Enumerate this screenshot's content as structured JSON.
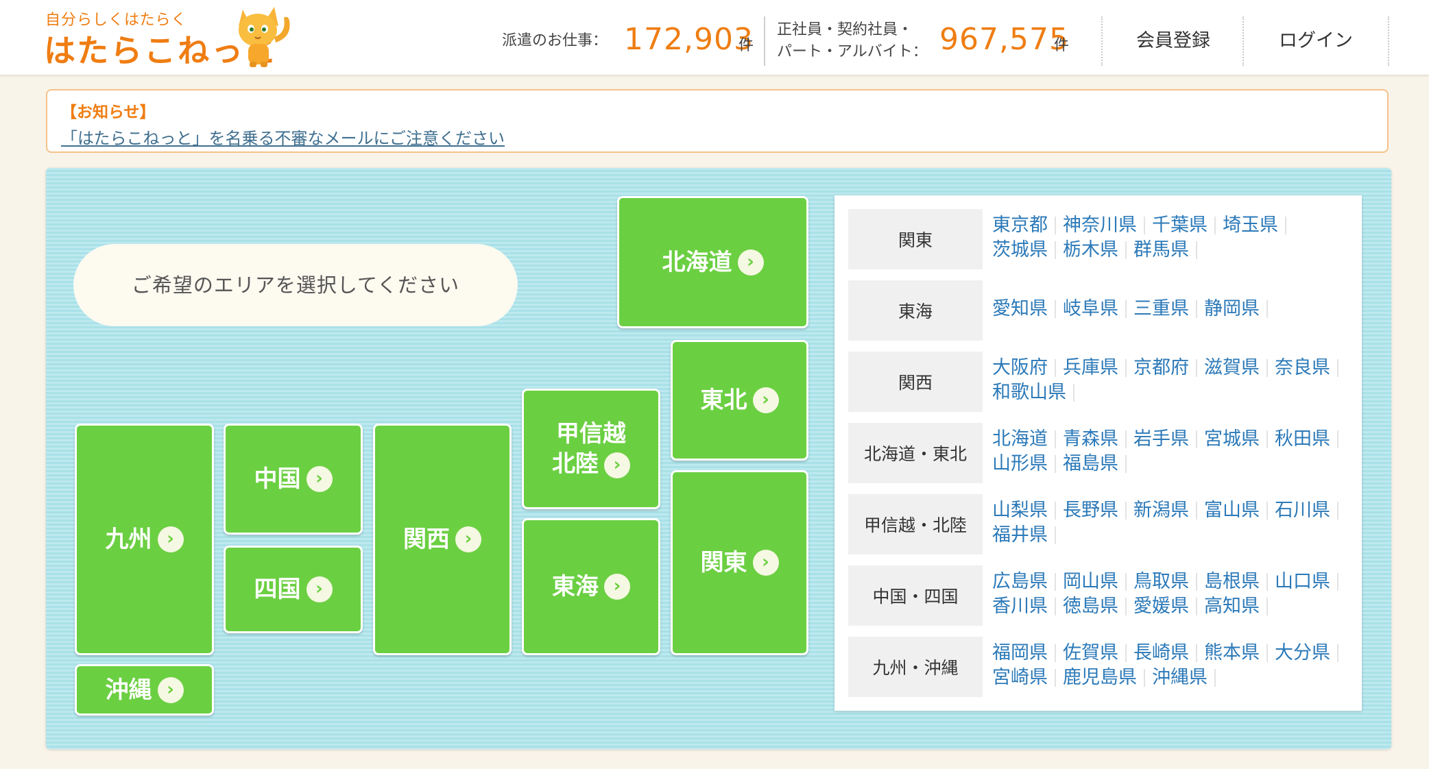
{
  "header": {
    "tagline": "自分らしくはたらく",
    "logo": "はたらこねっと",
    "haken_label": "派遣のお仕事：",
    "haken_count": "172,903",
    "haken_unit": "件",
    "seishain_label_1": "正社員・契約社員・",
    "seishain_label_2": "パート・アルバイト：",
    "seishain_count": "967,575",
    "seishain_unit": "件",
    "register": "会員登録",
    "login": "ログイン"
  },
  "notice": {
    "title": "【お知らせ】",
    "link": "「はたらこねっと」を名乗る不審なメールにご注意ください"
  },
  "map": {
    "prompt": "ご希望のエリアを選択してください",
    "arrow": "›",
    "regions": {
      "hokkaido": "北海道",
      "tohoku": "東北",
      "koshinetsu_1": "甲信越",
      "koshinetsu_2": "北陸",
      "kanto": "関東",
      "tokai": "東海",
      "kansai": "関西",
      "chugoku": "中国",
      "shikoku": "四国",
      "kyushu": "九州",
      "okinawa": "沖縄"
    }
  },
  "prefectures": [
    {
      "region": "関東",
      "prefs": [
        "東京都",
        "神奈川県",
        "千葉県",
        "埼玉県",
        "茨城県",
        "栃木県",
        "群馬県"
      ]
    },
    {
      "region": "東海",
      "prefs": [
        "愛知県",
        "岐阜県",
        "三重県",
        "静岡県"
      ]
    },
    {
      "region": "関西",
      "prefs": [
        "大阪府",
        "兵庫県",
        "京都府",
        "滋賀県",
        "奈良県",
        "和歌山県"
      ]
    },
    {
      "region": "北海道・東北",
      "prefs": [
        "北海道",
        "青森県",
        "岩手県",
        "宮城県",
        "秋田県",
        "山形県",
        "福島県"
      ]
    },
    {
      "region": "甲信越・北陸",
      "prefs": [
        "山梨県",
        "長野県",
        "新潟県",
        "富山県",
        "石川県",
        "福井県"
      ]
    },
    {
      "region": "中国・四国",
      "prefs": [
        "広島県",
        "岡山県",
        "鳥取県",
        "島根県",
        "山口県",
        "香川県",
        "徳島県",
        "愛媛県",
        "高知県"
      ]
    },
    {
      "region": "九州・沖縄",
      "prefs": [
        "福岡県",
        "佐賀県",
        "長崎県",
        "熊本県",
        "大分県",
        "宮崎県",
        "鹿児島県",
        "沖縄県"
      ]
    }
  ],
  "colors": {
    "brand_orange": "#ef7d12",
    "region_green": "#6bcf42",
    "link_blue": "#2b79b8",
    "panel_blue": "#bde9ef"
  }
}
